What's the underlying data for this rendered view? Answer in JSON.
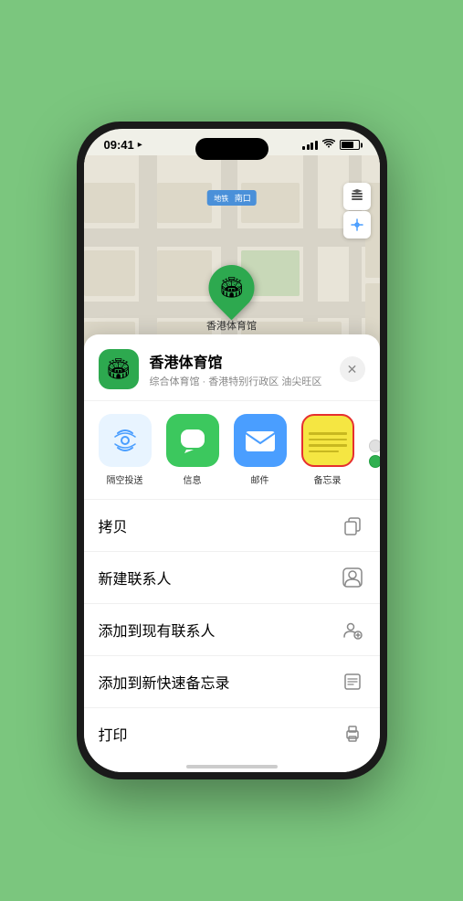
{
  "status_bar": {
    "time": "09:41",
    "location_arrow": "▶"
  },
  "map": {
    "label": "南口",
    "label_prefix": "地铁"
  },
  "map_controls": {
    "layers_icon": "🗺",
    "location_icon": "↗"
  },
  "marker": {
    "label": "香港体育馆",
    "emoji": "🏟"
  },
  "sheet": {
    "venue_icon": "🏟",
    "venue_name": "香港体育馆",
    "venue_sub": "综合体育馆 · 香港特别行政区 油尖旺区",
    "close_icon": "✕"
  },
  "share_items": [
    {
      "id": "airdrop",
      "label": "隔空投送",
      "emoji": "📡"
    },
    {
      "id": "messages",
      "label": "信息",
      "emoji": "💬"
    },
    {
      "id": "mail",
      "label": "邮件",
      "emoji": "✉"
    },
    {
      "id": "notes",
      "label": "备忘录",
      "emoji": ""
    }
  ],
  "actions": [
    {
      "label": "拷贝",
      "icon": "⎘"
    },
    {
      "label": "新建联系人",
      "icon": "👤"
    },
    {
      "label": "添加到现有联系人",
      "icon": "👤+"
    },
    {
      "label": "添加到新快速备忘录",
      "icon": "📝"
    },
    {
      "label": "打印",
      "icon": "🖨"
    }
  ],
  "colors": {
    "green": "#2da94f",
    "blue": "#4a9eff",
    "red": "#e63030",
    "yellow": "#f5e642"
  }
}
